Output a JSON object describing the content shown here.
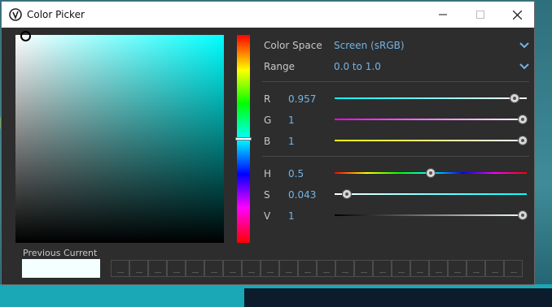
{
  "window": {
    "title": "Color Picker"
  },
  "settings": {
    "color_space_label": "Color Space",
    "color_space_value": "Screen (sRGB)",
    "range_label": "Range",
    "range_value": "0.0 to 1.0"
  },
  "rgb": {
    "r_label": "R",
    "r_value": "0.957",
    "g_label": "G",
    "g_value": "1",
    "b_label": "B",
    "b_value": "1"
  },
  "hsv": {
    "h_label": "H",
    "h_value": "0.5",
    "s_label": "S",
    "s_value": "0.043",
    "v_label": "V",
    "v_value": "1"
  },
  "slider_levels": {
    "r": 0.957,
    "g": 1.0,
    "b": 1.0,
    "h": 0.5,
    "s": 0.043,
    "v": 1.0
  },
  "swatches": {
    "previous_label": "Previous",
    "current_label": "Current",
    "current_color": "#f4ffff",
    "history_slot_count": 22
  },
  "colors": {
    "accent_text": "#74b4e6",
    "panel_bg": "#2d2d2d",
    "hue": "#00ffff"
  },
  "icons": {
    "app": "oddity-logo-icon",
    "minimize": "minimize-icon",
    "maximize": "maximize-icon",
    "close": "close-icon",
    "dropdown": "chevron-down-icon"
  }
}
